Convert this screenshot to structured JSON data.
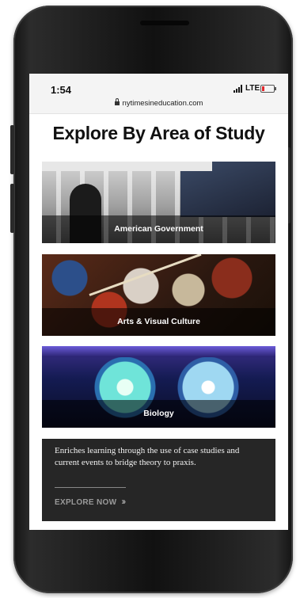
{
  "status_bar": {
    "time": "1:54",
    "network": "LTE",
    "url": "nytimesineducation.com",
    "icons": [
      "signal-icon",
      "battery-icon",
      "lock-icon"
    ]
  },
  "main": {
    "heading": "Explore By Area of Study",
    "cards": [
      {
        "label": "American Government"
      },
      {
        "label": "Arts & Visual Culture"
      },
      {
        "label": "Biology"
      }
    ],
    "info": {
      "text": "Enriches learning through the use of case studies and current events to bridge theory to praxis.",
      "cta": "EXPLORE NOW",
      "cta_icon": "double-chevron-right-icon"
    }
  },
  "colors": {
    "info_bg": "#262626",
    "battery_low": "#e3262b"
  }
}
